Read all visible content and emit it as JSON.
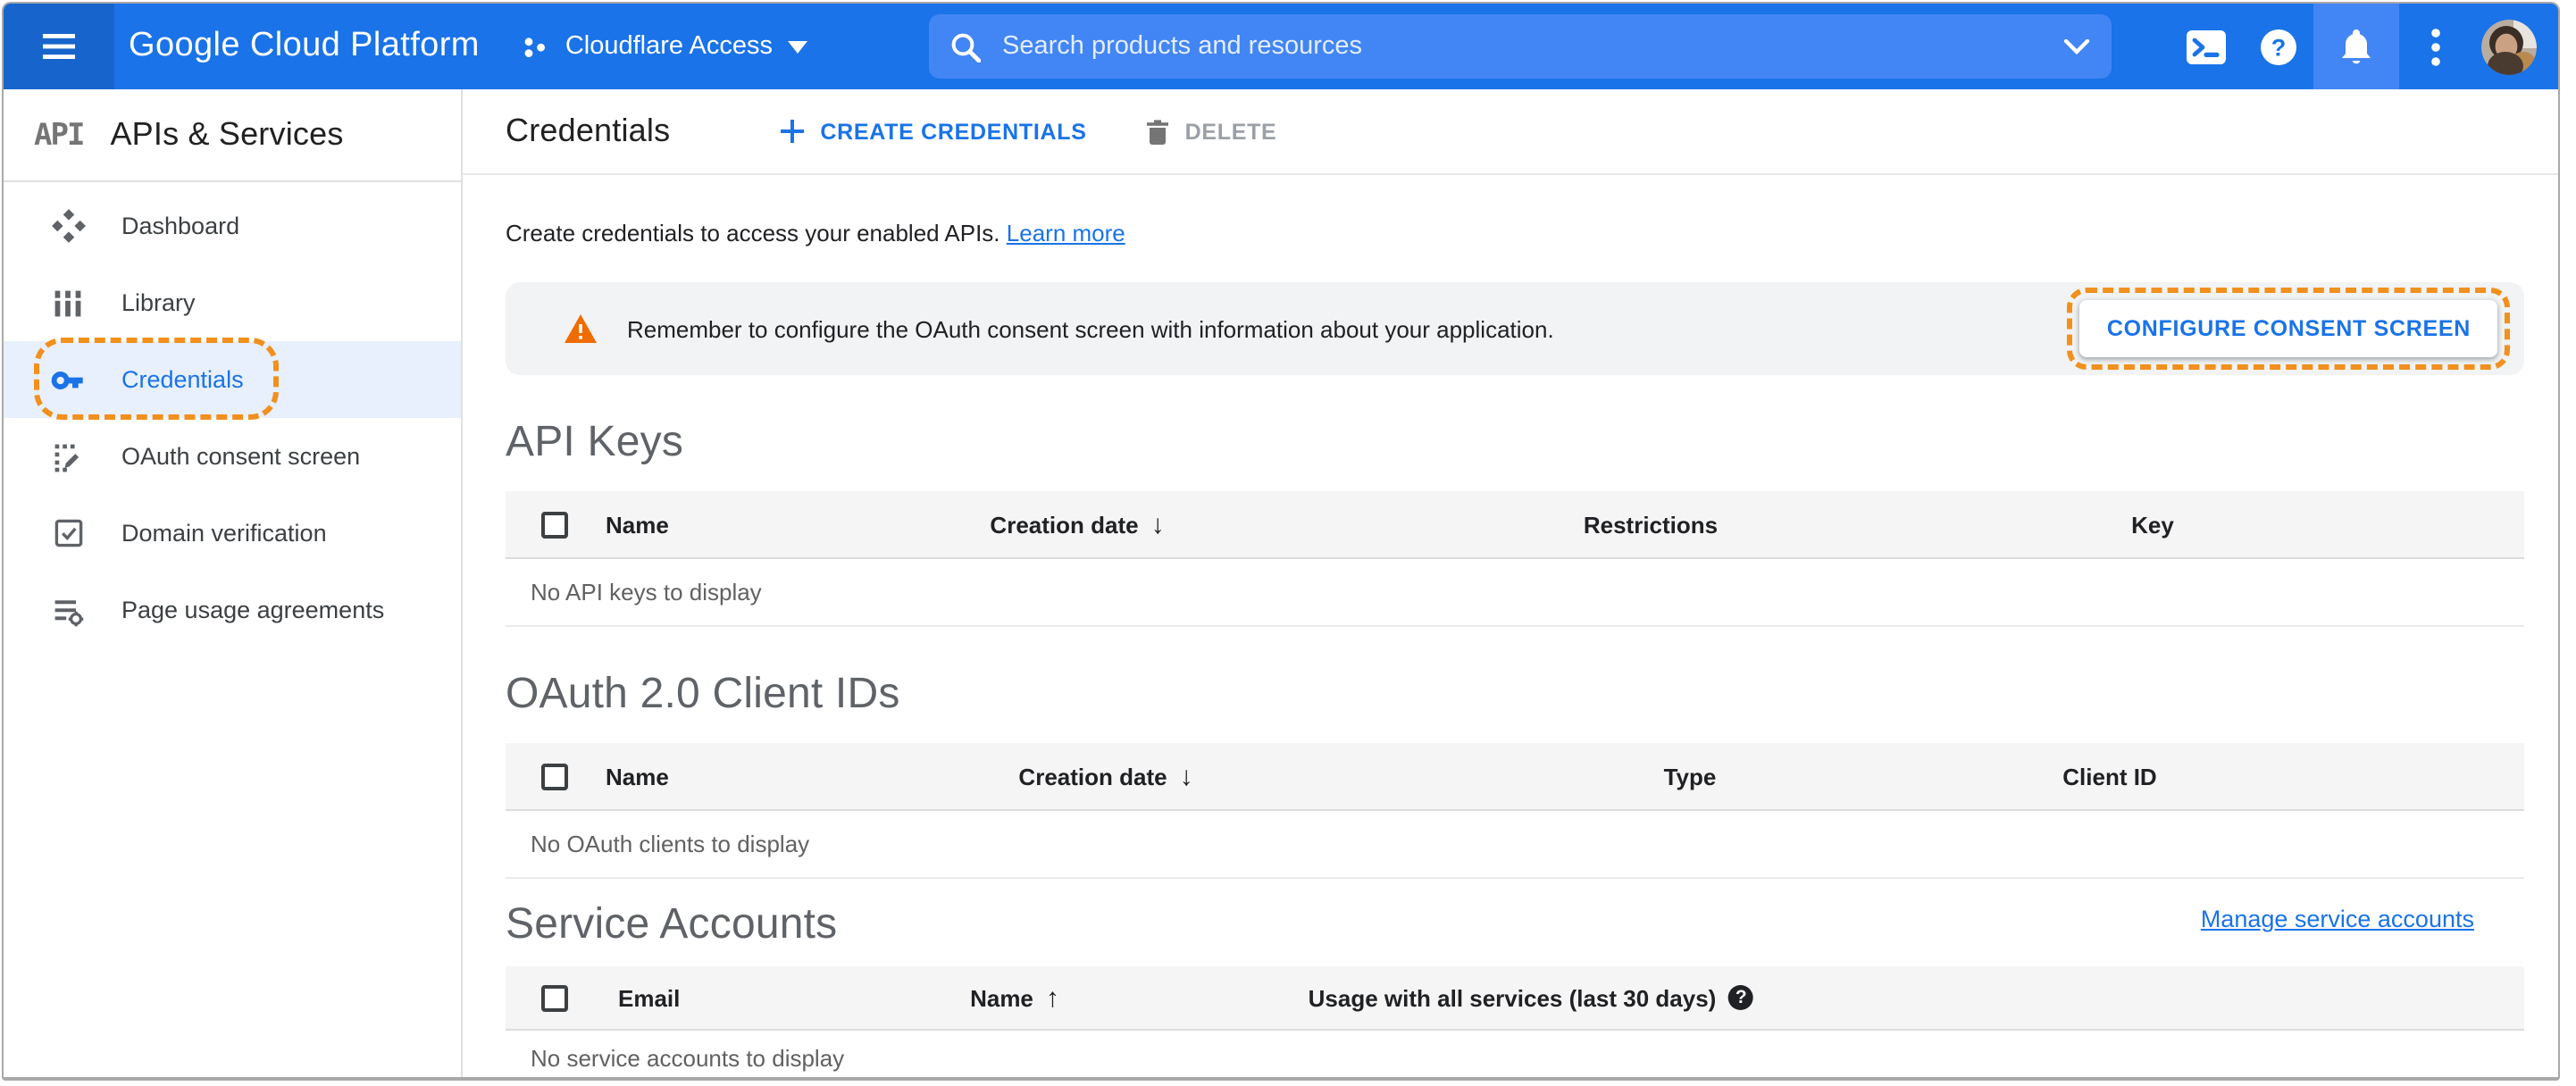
{
  "header": {
    "logo": "Google Cloud Platform",
    "project": "Cloudflare Access",
    "search_placeholder": "Search products and resources"
  },
  "sidebar": {
    "product_logo": "API",
    "title": "APIs & Services",
    "items": [
      {
        "label": "Dashboard"
      },
      {
        "label": "Library"
      },
      {
        "label": "Credentials",
        "selected": true
      },
      {
        "label": "OAuth consent screen"
      },
      {
        "label": "Domain verification"
      },
      {
        "label": "Page usage agreements"
      }
    ]
  },
  "toolbar": {
    "title": "Credentials",
    "create_label": "CREATE CREDENTIALS",
    "delete_label": "DELETE"
  },
  "intro": {
    "text": "Create credentials to access your enabled APIs.",
    "link": "Learn more"
  },
  "banner": {
    "text": "Remember to configure the OAuth consent screen with information about your application.",
    "button": "CONFIGURE CONSENT SCREEN"
  },
  "tables": {
    "api_keys": {
      "heading": "API Keys",
      "columns": {
        "name": "Name",
        "creation_date": "Creation date",
        "restrictions": "Restrictions",
        "key": "Key"
      },
      "sorted_by": "Creation date descending",
      "empty": "No API keys to display"
    },
    "oauth_clients": {
      "heading": "OAuth 2.0 Client IDs",
      "columns": {
        "name": "Name",
        "creation_date": "Creation date",
        "type": "Type",
        "client_id": "Client ID"
      },
      "sorted_by": "Creation date descending",
      "empty": "No OAuth clients to display"
    },
    "service_accounts": {
      "heading": "Service Accounts",
      "manage_link": "Manage service accounts",
      "columns": {
        "email": "Email",
        "name": "Name",
        "usage": "Usage with all services (last 30 days)"
      },
      "sorted_by": "Name ascending",
      "empty": "No service accounts to display"
    }
  },
  "glyphs": {
    "sort_desc": "↓",
    "sort_asc": "↑",
    "help": "?"
  },
  "colors": {
    "header_blue": "#1a73e8",
    "header_blue_dark": "#1765cc",
    "search_blue": "#4285f4",
    "selected_bg": "#e8f0fe",
    "annotation_orange": "#f1901c",
    "warning_orange": "#ef6c00",
    "link_blue": "#1a73e8"
  }
}
